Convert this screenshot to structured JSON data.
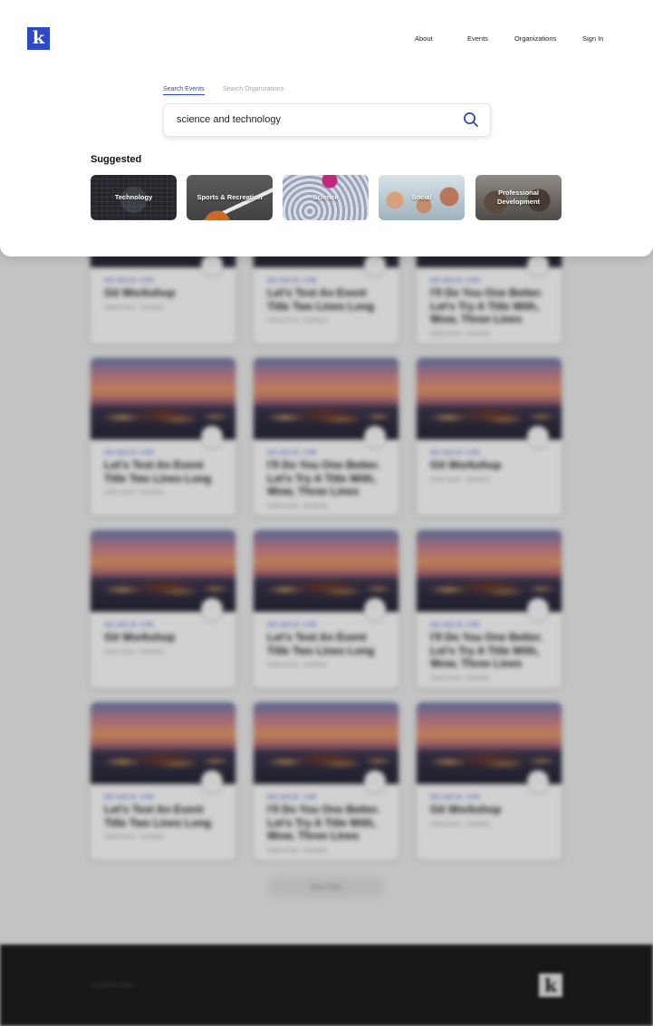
{
  "nav": {
    "logo_letter": "k",
    "links": [
      "About",
      "Events",
      "Organizations",
      "Sign In"
    ]
  },
  "search": {
    "tabs": [
      "Search Events",
      "Search Organizations"
    ],
    "active_tab": "Search Events",
    "query": "science and technology",
    "search_icon": "magnifier-icon"
  },
  "suggested": {
    "title": "Suggested",
    "categories": [
      "Technology",
      "Sports & Recreation",
      "Science",
      "Social",
      "Professional Development"
    ]
  },
  "background": {
    "cards": [
      {
        "date": "SAT, AUG 29 · 6 PM",
        "title": "Git Workshop",
        "meta": "Online Event · Hackbuds"
      },
      {
        "date": "SAT, AUG 29 · 6 PM",
        "title": "Let's Test An Event Title Two Lines Long",
        "meta": "Online Event · Hackbuds"
      },
      {
        "date": "SAT, AUG 29 · 6 PM",
        "title": "I'll Do You One Better. Let's Try A Title With, Wow, Three Lines",
        "meta": "Online Event · Hackbuds"
      },
      {
        "date": "SAT, AUG 29 · 6 PM",
        "title": "Let's Test An Event Title Two Lines Long",
        "meta": "Online Event · Hackbuds"
      },
      {
        "date": "SAT, AUG 29 · 6 PM",
        "title": "I'll Do You One Better. Let's Try A Title With, Wow, Three Lines",
        "meta": "Online Event · Hackbuds"
      },
      {
        "date": "SAT, AUG 29 · 6 PM",
        "title": "Git Workshop",
        "meta": "Online Event · Hackbuds"
      },
      {
        "date": "SAT, AUG 29 · 6 PM",
        "title": "Git Workshop",
        "meta": "Online Event · Hackbuds"
      },
      {
        "date": "SAT, AUG 29 · 6 PM",
        "title": "Let's Test An Event Title Two Lines Long",
        "meta": "Online Event · Hackbuds"
      },
      {
        "date": "SAT, AUG 29 · 6 PM",
        "title": "I'll Do You One Better. Let's Try A Title With, Wow, Three Lines",
        "meta": "Online Event · Hackbuds"
      },
      {
        "date": "SAT, AUG 29 · 6 PM",
        "title": "Let's Test An Event Title Two Lines Long",
        "meta": "Online Event · Hackbuds"
      },
      {
        "date": "SAT, AUG 29 · 6 PM",
        "title": "I'll Do You One Better. Let's Try A Title With, Wow, Three Lines",
        "meta": "Online Event · Hackbuds"
      },
      {
        "date": "SAT, AUG 29 · 6 PM",
        "title": "Git Workshop",
        "meta": "Online Event · Hackbuds"
      }
    ],
    "show_more": "Show More",
    "footer_copyright": "© Kommi 2020",
    "footer_logo_letter": "k"
  },
  "colors": {
    "accent": "#2f48c5",
    "footer": "#1d1d1d"
  }
}
